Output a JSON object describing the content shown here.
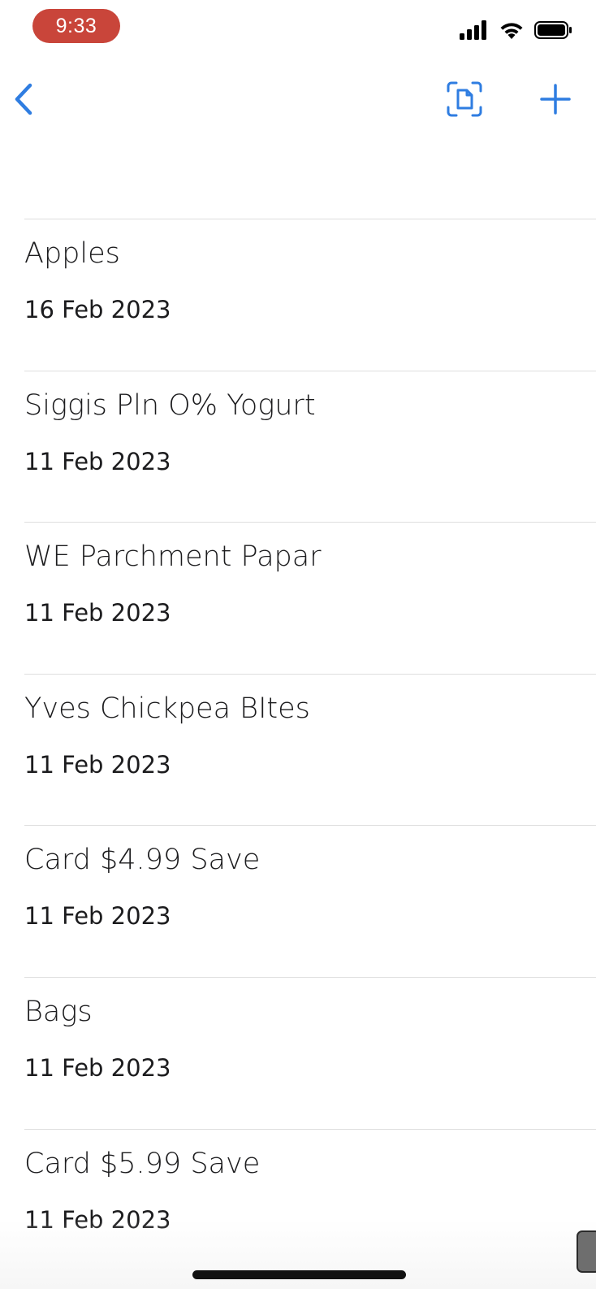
{
  "status_bar": {
    "time": "9:33",
    "signal_icon": "cellular-signal-icon",
    "wifi_icon": "wifi-icon",
    "battery_icon": "battery-full-icon"
  },
  "nav": {
    "back_icon": "chevron-left-icon",
    "scan_icon": "document-scan-icon",
    "add_icon": "plus-icon",
    "accent_color": "#2f7de1"
  },
  "items": [
    {
      "title": "Apples",
      "date": "16 Feb 2023"
    },
    {
      "title": "Siggis Pln O% Yogurt",
      "date": "11 Feb 2023"
    },
    {
      "title": "WE Parchment Papar",
      "date": "11 Feb 2023"
    },
    {
      "title": "Yves Chickpea BItes",
      "date": "11 Feb 2023"
    },
    {
      "title": "Card $4.99 Save",
      "date": "11 Feb 2023"
    },
    {
      "title": "Bags",
      "date": "11 Feb 2023"
    },
    {
      "title": "Card $5.99 Save",
      "date": "11 Feb 2023"
    }
  ]
}
